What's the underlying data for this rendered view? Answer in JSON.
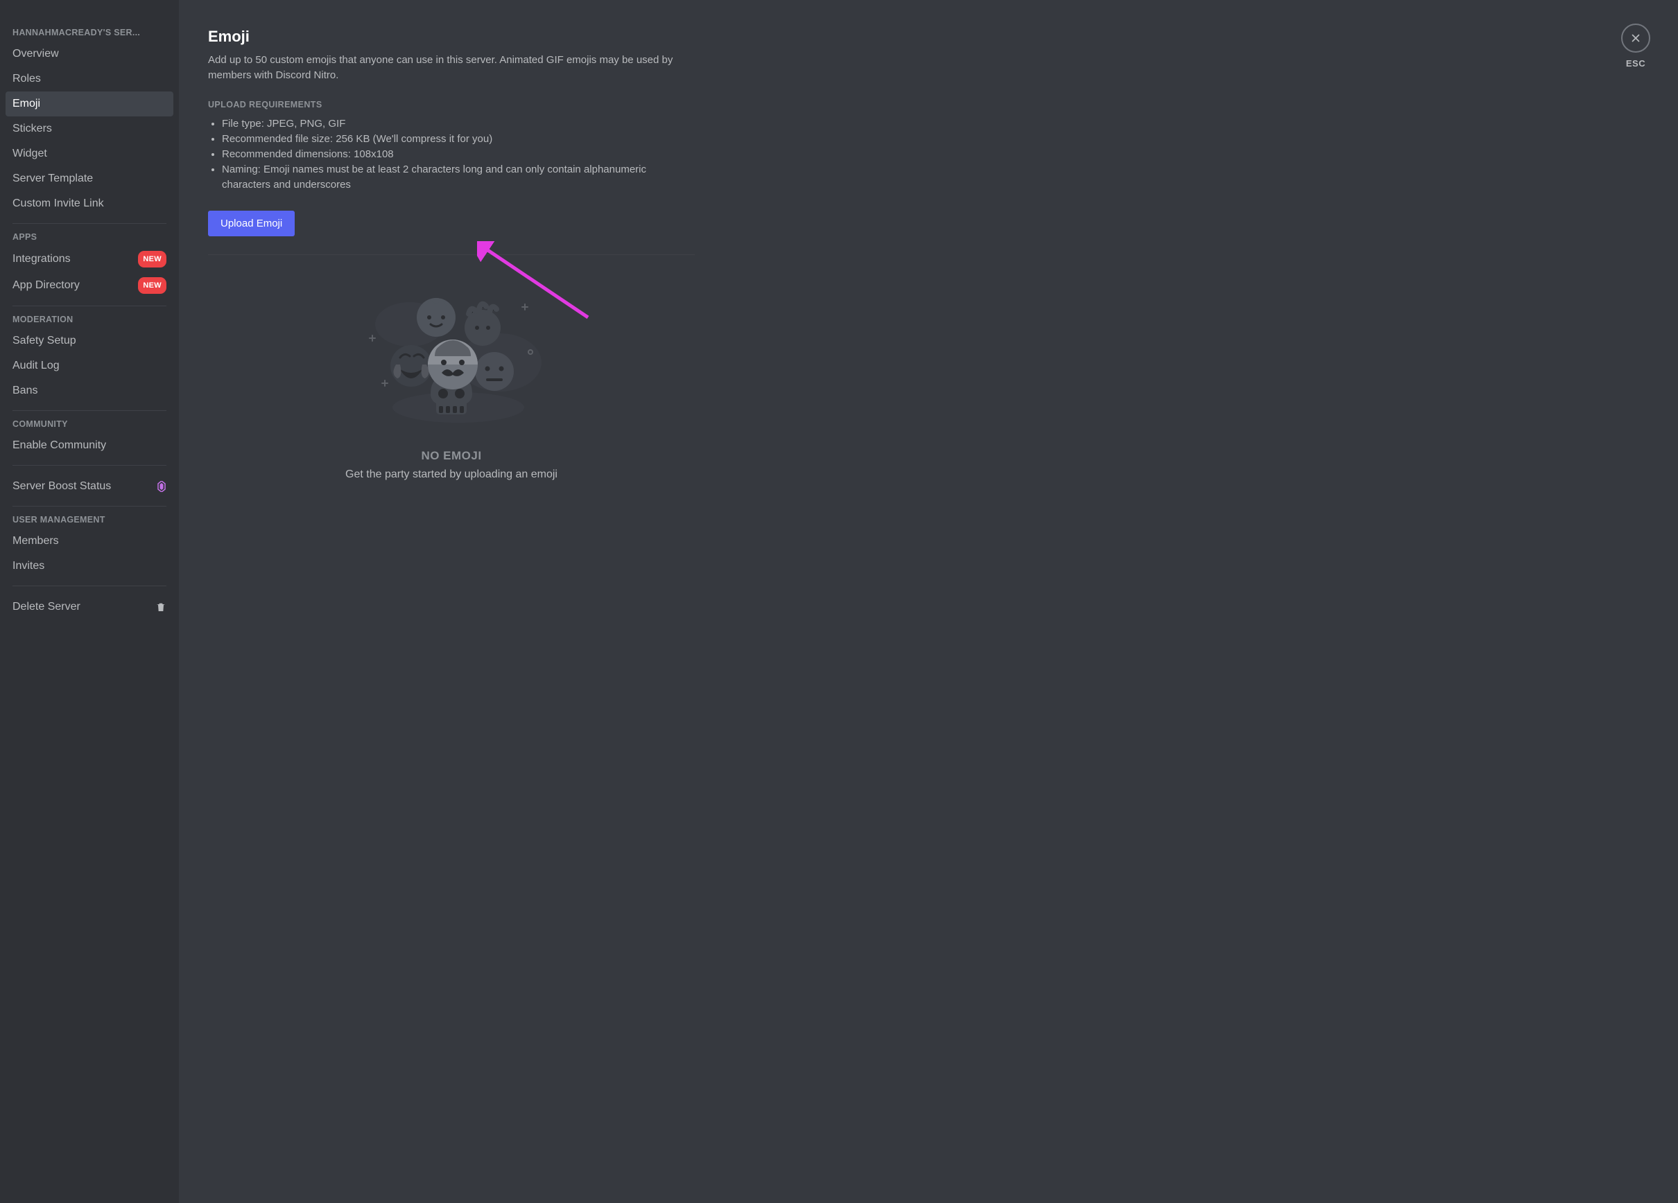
{
  "sidebar": {
    "server_name_header": "HANNAHMACREADY'S SER...",
    "group1": [
      {
        "label": "Overview"
      },
      {
        "label": "Roles"
      },
      {
        "label": "Emoji",
        "active": true
      },
      {
        "label": "Stickers"
      },
      {
        "label": "Widget"
      },
      {
        "label": "Server Template"
      },
      {
        "label": "Custom Invite Link"
      }
    ],
    "apps_header": "APPS",
    "apps": [
      {
        "label": "Integrations",
        "badge": "NEW"
      },
      {
        "label": "App Directory",
        "badge": "NEW"
      }
    ],
    "moderation_header": "MODERATION",
    "moderation": [
      {
        "label": "Safety Setup"
      },
      {
        "label": "Audit Log"
      },
      {
        "label": "Bans"
      }
    ],
    "community_header": "COMMUNITY",
    "community": [
      {
        "label": "Enable Community"
      }
    ],
    "boost_label": "Server Boost Status",
    "user_mgmt_header": "USER MANAGEMENT",
    "user_mgmt": [
      {
        "label": "Members"
      },
      {
        "label": "Invites"
      }
    ],
    "delete_label": "Delete Server"
  },
  "page": {
    "title": "Emoji",
    "description": "Add up to 50 custom emojis that anyone can use in this server. Animated GIF emojis may be used by members with Discord Nitro.",
    "requirements_header": "UPLOAD REQUIREMENTS",
    "requirements": [
      "File type: JPEG, PNG, GIF",
      "Recommended file size: 256 KB (We'll compress it for you)",
      "Recommended dimensions: 108x108",
      "Naming: Emoji names must be at least 2 characters long and can only contain alphanumeric characters and underscores"
    ],
    "upload_button": "Upload Emoji",
    "empty_title": "NO EMOJI",
    "empty_subtitle": "Get the party started by uploading an emoji"
  },
  "close": {
    "label": "ESC"
  },
  "colors": {
    "brand": "#5865f2",
    "badge_red": "#ed4245",
    "annotation": "#e23ae2"
  }
}
